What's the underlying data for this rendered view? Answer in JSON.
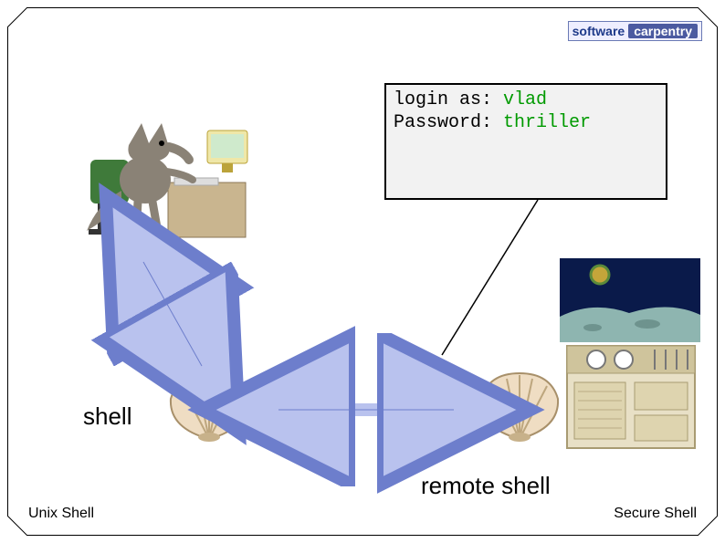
{
  "logo": {
    "part1": "software",
    "part2": "carpentry"
  },
  "terminal": {
    "line1_prompt": "login as:",
    "line1_input": " vlad",
    "line2_prompt": "Password:",
    "line2_input": " thriller"
  },
  "labels": {
    "shell": "shell",
    "remote_shell": "remote shell"
  },
  "footer": {
    "left": "Unix Shell",
    "right": "Secure Shell"
  },
  "illustrations": {
    "wolf": "wolf-at-computer",
    "shell_local": "seashell",
    "shell_remote": "seashell",
    "remote_machine": "moon-base-computer"
  },
  "arrows": {
    "a1": "wolf↔local-shell",
    "a2": "local-shell↔remote-shell",
    "a3": "terminal→remote-shell-pointer"
  }
}
